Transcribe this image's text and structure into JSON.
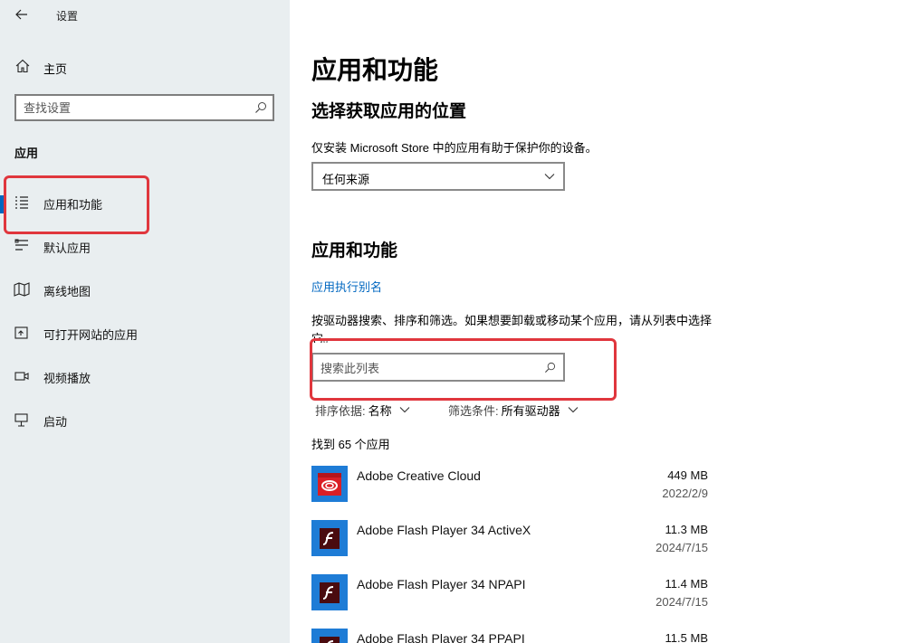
{
  "window": {
    "title": "设置"
  },
  "sidebar": {
    "home_label": "主页",
    "search_placeholder": "查找设置",
    "section_title": "应用",
    "items": [
      {
        "label": "应用和功能",
        "icon": "apps-list-icon",
        "selected": true
      },
      {
        "label": "默认应用",
        "icon": "default-apps-icon"
      },
      {
        "label": "离线地图",
        "icon": "map-icon"
      },
      {
        "label": "可打开网站的应用",
        "icon": "open-website-icon"
      },
      {
        "label": "视频播放",
        "icon": "video-icon"
      },
      {
        "label": "启动",
        "icon": "startup-icon"
      }
    ]
  },
  "main": {
    "title": "应用和功能",
    "install_section": {
      "heading": "选择获取应用的位置",
      "description": "仅安装 Microsoft Store 中的应用有助于保护你的设备。",
      "dropdown_value": "任何来源"
    },
    "apps_section": {
      "heading": "应用和功能",
      "alias_link": "应用执行别名",
      "description": "按驱动器搜索、排序和筛选。如果想要卸载或移动某个应用，请从列表中选择它。",
      "search_placeholder": "搜索此列表",
      "sort": {
        "label": "排序依据:",
        "value": "名称"
      },
      "filter": {
        "label": "筛选条件:",
        "value": "所有驱动器"
      },
      "count_text": "找到 65 个应用",
      "apps": [
        {
          "name": "Adobe Creative Cloud",
          "size": "449 MB",
          "date": "2022/2/9",
          "icon": "creative-cloud-icon"
        },
        {
          "name": "Adobe Flash Player 34 ActiveX",
          "size": "11.3 MB",
          "date": "2024/7/15",
          "icon": "flash-player-icon"
        },
        {
          "name": "Adobe Flash Player 34 NPAPI",
          "size": "11.4 MB",
          "date": "2024/7/15",
          "icon": "flash-player-icon"
        },
        {
          "name": "Adobe Flash Player 34 PPAPI",
          "size": "11.5 MB",
          "date": "",
          "icon": "flash-player-icon"
        }
      ]
    }
  },
  "colors": {
    "accent": "#0067c0",
    "annotation": "#e0363d",
    "sidebar_bg": "#e9eef0",
    "app_tile": "#1e7cd6"
  }
}
